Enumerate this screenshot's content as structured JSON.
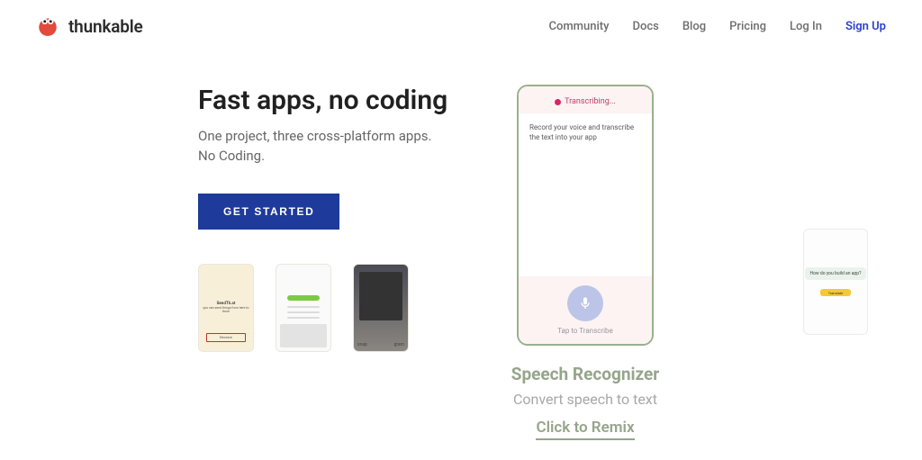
{
  "brand": {
    "name": "thunkable"
  },
  "nav": {
    "community": "Community",
    "docs": "Docs",
    "blog": "Blog",
    "pricing": "Pricing",
    "login": "Log In",
    "signup": "Sign Up"
  },
  "hero": {
    "title": "Fast apps, no coding",
    "subtitle": "One project, three cross-platform apps. No Coding.",
    "cta": "GET STARTED"
  },
  "thumbs": {
    "tan_title": "SendTh.at",
    "tan_sub": "you can send things from here to there",
    "tan_box": "Receive",
    "photo_left": "snap",
    "photo_right": "gram"
  },
  "phone_main": {
    "status": "Transcribing...",
    "desc": "Record your voice and transcribe the text into your app",
    "tap": "Tap to Transcribe"
  },
  "caption": {
    "title": "Speech Recognizer",
    "subtitle": "Convert speech to text",
    "remix": "Click to Remix"
  },
  "phone_small": {
    "bubble": "How do you build an app?",
    "btn": "Translate"
  }
}
